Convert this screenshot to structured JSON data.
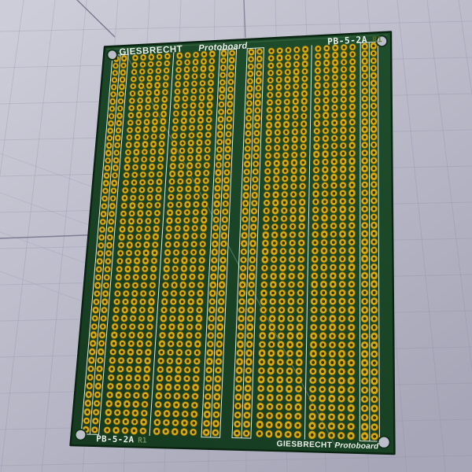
{
  "viewer": {
    "type": "pcb-3d-view"
  },
  "background": {
    "color_top": "#cdcdd9",
    "color_bottom": "#a6a6b8",
    "grid_color": "#8f8fa6",
    "accent_line_color": "#6d6d86"
  },
  "board": {
    "mask_color": "#1f4e2c",
    "mask_color_dark": "#153a1f",
    "edge_color": "#0b2412",
    "edge_highlight": "#35643f",
    "silk_color": "#ebf0ea",
    "ref_color_top": "#5f6e2e",
    "ref_color_bottom": "#7f9a66",
    "pad_ring_color": "#d8ab0e",
    "pad_ring_edge": "#85680a",
    "pad_hole_color": "#343008",
    "mount_hole_fill": "#bdbdcb",
    "mount_hole_rim": "#11301a",
    "reflection_color": "#d8dde8",
    "labels": {
      "top_left_brand": "GIESBRECHT",
      "top_left_product": "Protoboard",
      "top_right_part": "PB-5-2A",
      "top_right_ref": "R1",
      "bottom_left_part": "PB-5-2A",
      "bottom_left_ref": "R1",
      "bottom_right_brand": "GIESBRECHT",
      "bottom_right_product": "Protoboard"
    },
    "matrix": {
      "rows": 48,
      "halves": 2,
      "rail_columns_per_side": 2,
      "field_columns_per_group": 5,
      "groups_per_half": 2,
      "columns_per_half": 14,
      "total_columns": 28,
      "total_pads": 1344
    }
  }
}
